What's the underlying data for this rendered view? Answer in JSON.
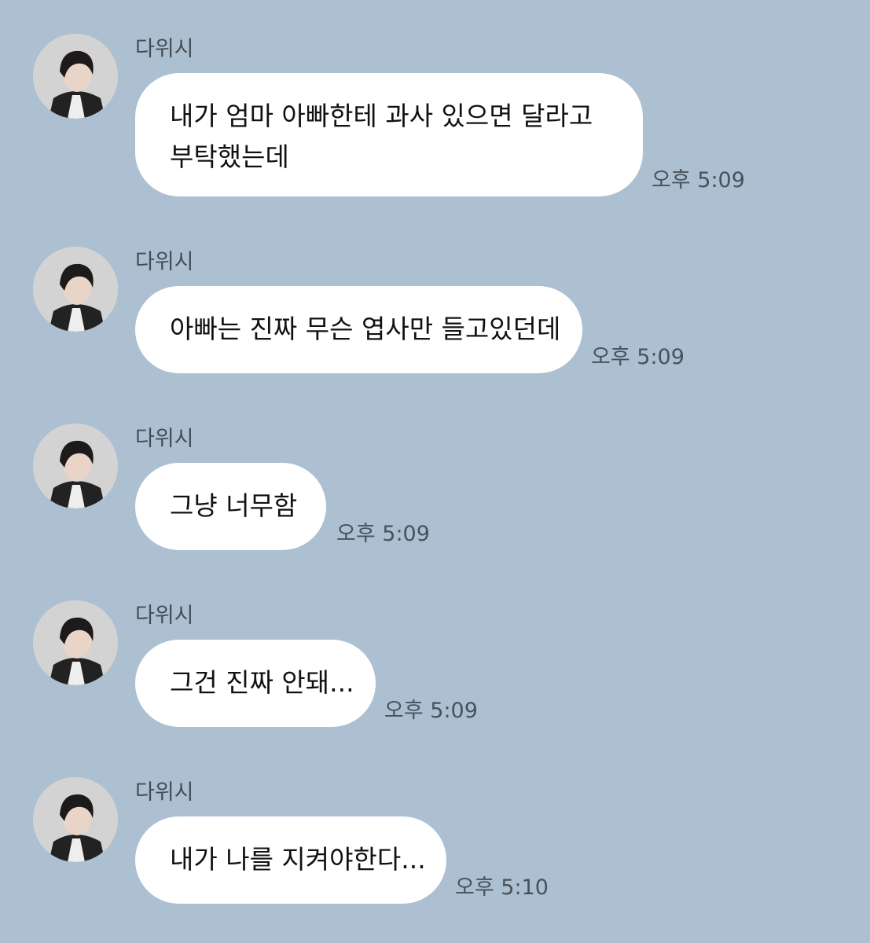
{
  "messages": [
    {
      "sender": "다위시",
      "lines": [
        "내가 엄마 아빠한테 과사 있으면 달라고",
        "부탁했는데"
      ],
      "time": "오후 5:09"
    },
    {
      "sender": "다위시",
      "lines": [
        "아빠는 진짜 무슨 엽사만 들고있던데"
      ],
      "time": "오후 5:09"
    },
    {
      "sender": "다위시",
      "lines": [
        "그냥 너무함"
      ],
      "time": "오후 5:09"
    },
    {
      "sender": "다위시",
      "lines": [
        "그건 진짜 안돼..."
      ],
      "time": "오후 5:09"
    },
    {
      "sender": "다위시",
      "lines": [
        "내가 나를 지켜야한다..."
      ],
      "time": "오후 5:10"
    }
  ],
  "colors": {
    "background": "#adc0d1",
    "bubble": "#ffffff",
    "timestamp": "#47525c",
    "sender": "#444d55"
  },
  "icons": {
    "avatar": "profile-photo-avatar"
  }
}
